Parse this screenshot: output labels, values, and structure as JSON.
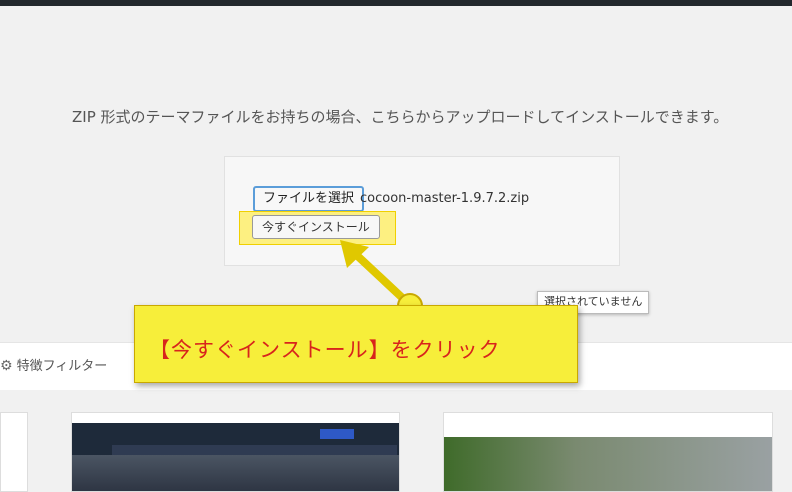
{
  "upload": {
    "instructions": "ZIP 形式のテーマファイルをお持ちの場合、こちらからアップロードしてインストールできます。",
    "choose_file_label": "ファイルを選択",
    "file_name": "cocoon-master-1.9.7.2.zip",
    "install_now_label": "今すぐインストール"
  },
  "tooltip": {
    "text": "選択されていません"
  },
  "filter": {
    "label": "特徴フィルター",
    "icon": "gear-icon"
  },
  "annotation": {
    "text": "【今すぐインストール】をクリック",
    "callout_color": "#f7ee3a",
    "text_color": "#d8241c"
  }
}
